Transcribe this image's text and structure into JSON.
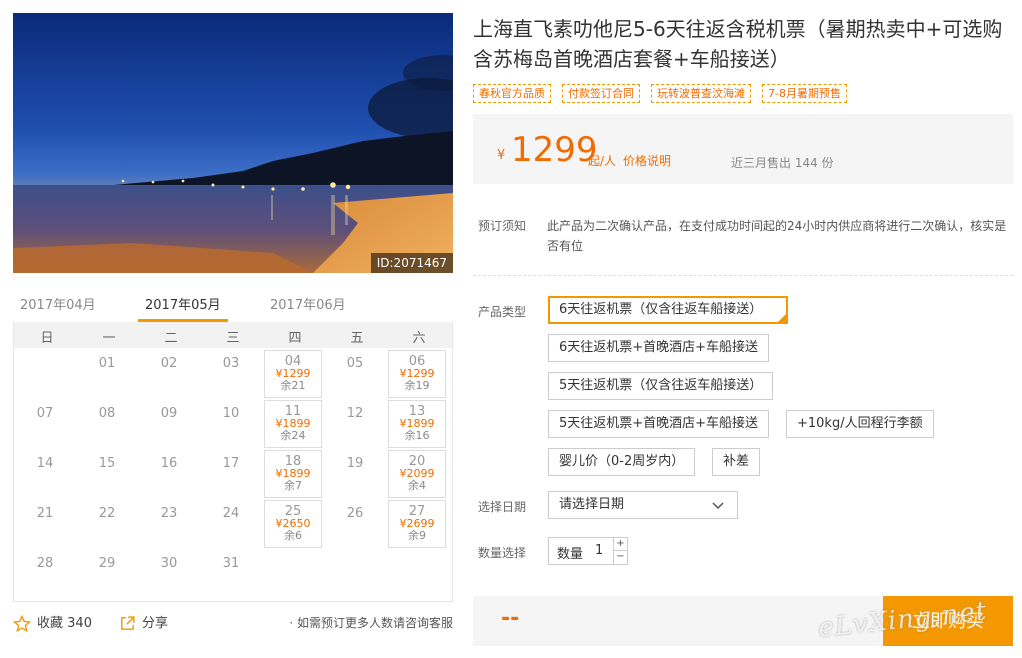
{
  "photo": {
    "id_label": "ID:2071467"
  },
  "months": [
    "2017年04月",
    "2017年05月",
    "2017年06月"
  ],
  "weekdays": [
    "日",
    "一",
    "二",
    "三",
    "四",
    "五",
    "六"
  ],
  "calendar_days": [
    {
      "d": "",
      "price": "",
      "left": ""
    },
    {
      "d": "01",
      "price": "",
      "left": ""
    },
    {
      "d": "02",
      "price": "",
      "left": ""
    },
    {
      "d": "03",
      "price": "",
      "left": ""
    },
    {
      "d": "04",
      "price": "¥1299",
      "left": "余21"
    },
    {
      "d": "05",
      "price": "",
      "left": ""
    },
    {
      "d": "06",
      "price": "¥1299",
      "left": "余19"
    },
    {
      "d": "07",
      "price": "",
      "left": ""
    },
    {
      "d": "08",
      "price": "",
      "left": ""
    },
    {
      "d": "09",
      "price": "",
      "left": ""
    },
    {
      "d": "10",
      "price": "",
      "left": ""
    },
    {
      "d": "11",
      "price": "¥1899",
      "left": "余24"
    },
    {
      "d": "12",
      "price": "",
      "left": ""
    },
    {
      "d": "13",
      "price": "¥1899",
      "left": "余16"
    },
    {
      "d": "14",
      "price": "",
      "left": ""
    },
    {
      "d": "15",
      "price": "",
      "left": ""
    },
    {
      "d": "16",
      "price": "",
      "left": ""
    },
    {
      "d": "17",
      "price": "",
      "left": ""
    },
    {
      "d": "18",
      "price": "¥1899",
      "left": "余7"
    },
    {
      "d": "19",
      "price": "",
      "left": ""
    },
    {
      "d": "20",
      "price": "¥2099",
      "left": "余4"
    },
    {
      "d": "21",
      "price": "",
      "left": ""
    },
    {
      "d": "22",
      "price": "",
      "left": ""
    },
    {
      "d": "23",
      "price": "",
      "left": ""
    },
    {
      "d": "24",
      "price": "",
      "left": ""
    },
    {
      "d": "25",
      "price": "¥2650",
      "left": "余6"
    },
    {
      "d": "26",
      "price": "",
      "left": ""
    },
    {
      "d": "27",
      "price": "¥2699",
      "left": "余9"
    },
    {
      "d": "28",
      "price": "",
      "left": ""
    },
    {
      "d": "29",
      "price": "",
      "left": ""
    },
    {
      "d": "30",
      "price": "",
      "left": ""
    },
    {
      "d": "31",
      "price": "",
      "left": ""
    }
  ],
  "actions": {
    "favorite_label": "收藏",
    "favorite_count": "340",
    "share_label": "分享",
    "note": "· 如需预订更多人数请咨询客服"
  },
  "product": {
    "title": "上海直飞素叻他尼5-6天往返含税机票（暑期热卖中+可选购含苏梅岛首晚酒店套餐+车船接送）",
    "tags": [
      "春秋官方品质",
      "付款签订合同",
      "玩转波普查汶海滩",
      "7-8月暑期预售"
    ]
  },
  "price": {
    "currency": "¥",
    "amount": "1299",
    "unit": "起/人",
    "explain_link": "价格说明",
    "sold": "近三月售出 144 份"
  },
  "notice": {
    "label": "预订须知",
    "text": "此产品为二次确认产品，在支付成功时间起的24小时内供应商将进行二次确认，核实是否有位"
  },
  "options": {
    "type_label": "产品类型",
    "items": [
      "6天往返机票（仅含往返车船接送）",
      "6天往返机票+首晚酒店+车船接送",
      "5天往返机票（仅含往返车船接送）",
      "5天往返机票+首晚酒店+车船接送",
      "+10kg/人回程行李额",
      "婴儿价（0-2周岁内）",
      "补差"
    ],
    "date_label": "选择日期",
    "date_placeholder": "请选择日期",
    "qty_label": "数量选择",
    "qty_inner_label": "数量",
    "qty_value": "1",
    "qty_up": "+",
    "qty_down": "−"
  },
  "buy": {
    "price_placeholder": "--",
    "button": "立即购买"
  },
  "watermark": "eLvXing.net",
  "colors": {
    "accent": "#f39800",
    "price": "#f06c00"
  }
}
